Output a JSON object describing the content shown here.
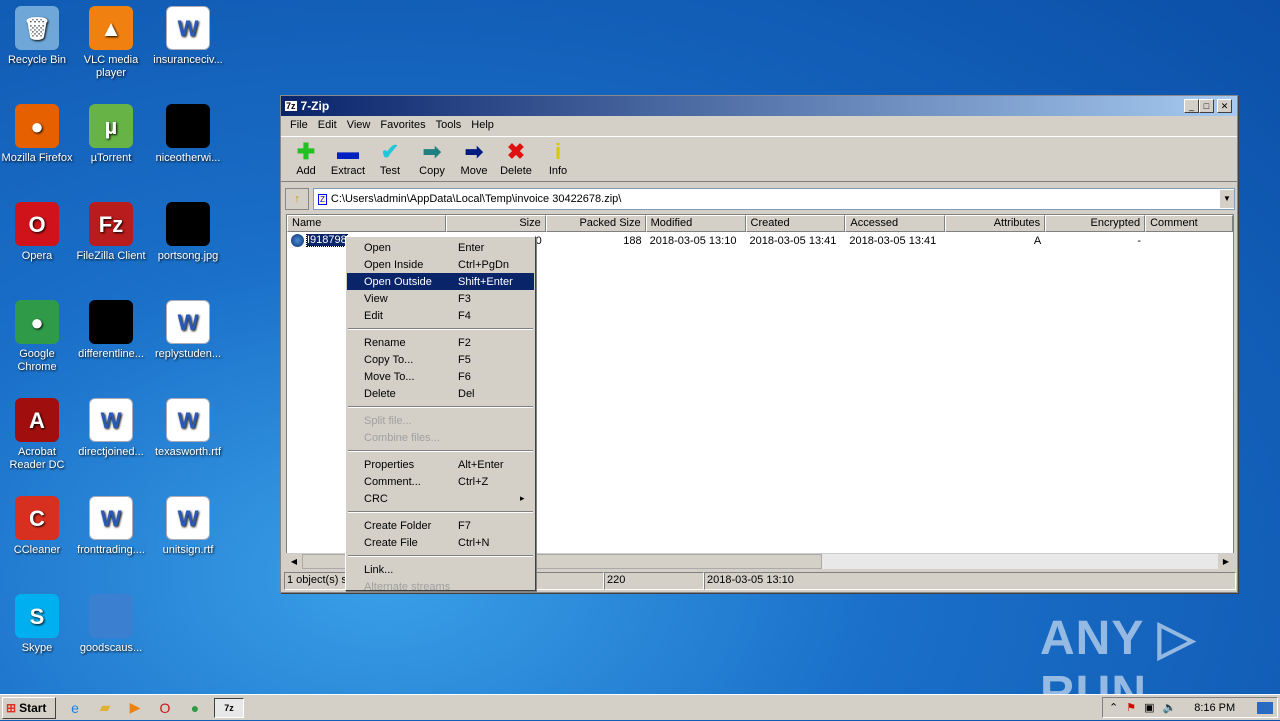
{
  "desktop": {
    "icons": [
      {
        "label": "Recycle Bin",
        "icon": "recycle-bin-icon",
        "color": "#6fa8d8",
        "glyph": "🗑"
      },
      {
        "label": "VLC media player",
        "icon": "vlc-icon",
        "color": "#f08010",
        "glyph": "▲"
      },
      {
        "label": "insuranceciv...",
        "icon": "word-doc-icon",
        "color": "#fff",
        "glyph": "W"
      },
      {
        "label": "Mozilla Firefox",
        "icon": "firefox-icon",
        "color": "#e66000",
        "glyph": "●"
      },
      {
        "label": "µTorrent",
        "icon": "utorrent-icon",
        "color": "#67b346",
        "glyph": "µ"
      },
      {
        "label": "niceotherwi...",
        "icon": "black-thumbnail-icon",
        "color": "#000",
        "glyph": ""
      },
      {
        "label": "Opera",
        "icon": "opera-icon",
        "color": "#d0121a",
        "glyph": "O"
      },
      {
        "label": "FileZilla Client",
        "icon": "filezilla-icon",
        "color": "#b81c1c",
        "glyph": "Fz"
      },
      {
        "label": "portsong.jpg",
        "icon": "black-thumbnail-icon",
        "color": "#000",
        "glyph": ""
      },
      {
        "label": "Google Chrome",
        "icon": "chrome-icon",
        "color": "#2f9a48",
        "glyph": "●"
      },
      {
        "label": "differentline...",
        "icon": "black-thumbnail-icon",
        "color": "#000",
        "glyph": ""
      },
      {
        "label": "replystuden...",
        "icon": "word-doc-icon",
        "color": "#fff",
        "glyph": "W"
      },
      {
        "label": "Acrobat Reader DC",
        "icon": "acrobat-icon",
        "color": "#a10e0e",
        "glyph": "A"
      },
      {
        "label": "directjoined...",
        "icon": "word-doc-icon",
        "color": "#fff",
        "glyph": "W"
      },
      {
        "label": "texasworth.rtf",
        "icon": "word-doc-icon",
        "color": "#fff",
        "glyph": "W"
      },
      {
        "label": "CCleaner",
        "icon": "ccleaner-icon",
        "color": "#d83020",
        "glyph": "C"
      },
      {
        "label": "fronttrading....",
        "icon": "word-doc-icon",
        "color": "#fff",
        "glyph": "W"
      },
      {
        "label": "unitsign.rtf",
        "icon": "word-doc-icon",
        "color": "#fff",
        "glyph": "W"
      },
      {
        "label": "Skype",
        "icon": "skype-icon",
        "color": "#00aff0",
        "glyph": "S"
      },
      {
        "label": "goodscaus...",
        "icon": "blank-file-icon",
        "color": "#3a7fd0",
        "glyph": ""
      }
    ]
  },
  "window": {
    "app_icon": "7z",
    "title": "7-Zip",
    "controls": [
      "_",
      "□",
      "✕"
    ],
    "menu": [
      "File",
      "Edit",
      "View",
      "Favorites",
      "Tools",
      "Help"
    ],
    "toolbar": [
      {
        "label": "Add",
        "icon": "add-icon",
        "glyph": "✚",
        "color": "#22c022"
      },
      {
        "label": "Extract",
        "icon": "extract-icon",
        "glyph": "▬",
        "color": "#0020c0"
      },
      {
        "label": "Test",
        "icon": "test-icon",
        "glyph": "✔",
        "color": "#20c8d8"
      },
      {
        "label": "Copy",
        "icon": "copy-icon",
        "glyph": "➡",
        "color": "#208080"
      },
      {
        "label": "Move",
        "icon": "move-icon",
        "glyph": "➡",
        "color": "#001c80"
      },
      {
        "label": "Delete",
        "icon": "delete-icon",
        "glyph": "✖",
        "color": "#e01010"
      },
      {
        "label": "Info",
        "icon": "info-icon",
        "glyph": "i",
        "color": "#d8c800"
      }
    ],
    "address": "C:\\Users\\admin\\AppData\\Local\\Temp\\invoice 30422678.zip\\",
    "columns": [
      "Name",
      "Size",
      "Packed Size",
      "Modified",
      "Created",
      "Accessed",
      "Attributes",
      "Encrypted",
      "Comment"
    ],
    "rows": [
      {
        "name": "I918798",
        "size": "0",
        "packed": "188",
        "modified": "2018-03-05 13:10",
        "created": "2018-03-05 13:41",
        "accessed": "2018-03-05 13:41",
        "attributes": "A",
        "encrypted": "-",
        "comment": ""
      }
    ],
    "status": [
      "1 object(s) s",
      "",
      "220",
      "2018-03-05 13:10"
    ]
  },
  "context_menu": {
    "groups": [
      [
        {
          "label": "Open",
          "key": "Enter"
        },
        {
          "label": "Open Inside",
          "key": "Ctrl+PgDn"
        },
        {
          "label": "Open Outside",
          "key": "Shift+Enter",
          "selected": true
        },
        {
          "label": "View",
          "key": "F3"
        },
        {
          "label": "Edit",
          "key": "F4"
        }
      ],
      [
        {
          "label": "Rename",
          "key": "F2"
        },
        {
          "label": "Copy To...",
          "key": "F5"
        },
        {
          "label": "Move To...",
          "key": "F6"
        },
        {
          "label": "Delete",
          "key": "Del"
        }
      ],
      [
        {
          "label": "Split file...",
          "key": "",
          "disabled": true
        },
        {
          "label": "Combine files...",
          "key": "",
          "disabled": true
        }
      ],
      [
        {
          "label": "Properties",
          "key": "Alt+Enter"
        },
        {
          "label": "Comment...",
          "key": "Ctrl+Z"
        },
        {
          "label": "CRC",
          "key": "▸"
        }
      ],
      [
        {
          "label": "Create Folder",
          "key": "F7"
        },
        {
          "label": "Create File",
          "key": "Ctrl+N"
        }
      ],
      [
        {
          "label": "Link...",
          "key": ""
        },
        {
          "label": "Alternate streams",
          "key": "",
          "disabled": true
        }
      ]
    ]
  },
  "taskbar": {
    "start": "Start",
    "clock": "8:16 PM",
    "active_task": "7z"
  },
  "watermark": "ANY ▷ RUN"
}
